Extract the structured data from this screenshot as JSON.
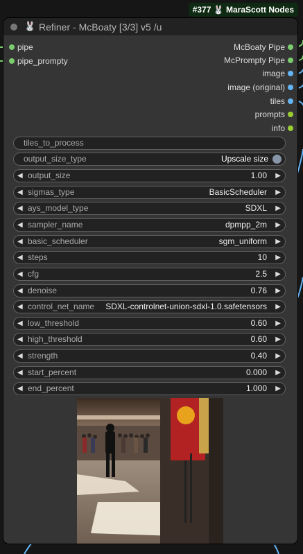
{
  "badge": {
    "text": "#377 🐰 MaraScott Nodes"
  },
  "node": {
    "title": "Refiner - McBoaty [3/3] v5 /u",
    "inputs": [
      "pipe",
      "pipe_prompty"
    ],
    "outputs": [
      {
        "label": "McBoaty Pipe",
        "color": "#7bcc6e"
      },
      {
        "label": "McPrompty Pipe",
        "color": "#7bcc6e"
      },
      {
        "label": "image",
        "color": "#64b5f6"
      },
      {
        "label": "image (original)",
        "color": "#64b5f6"
      },
      {
        "label": "tiles",
        "color": "#64b5f6"
      },
      {
        "label": "prompts",
        "color": "#9acd32"
      },
      {
        "label": "info",
        "color": "#9acd32"
      }
    ],
    "widgets": {
      "tiles_to_process": {
        "name": "tiles_to_process",
        "value": ""
      },
      "output_size_type": {
        "name": "output_size_type",
        "value": "Upscale size"
      },
      "output_size": {
        "name": "output_size",
        "value": "1.00"
      },
      "sigmas_type": {
        "name": "sigmas_type",
        "value": "BasicScheduler"
      },
      "ays_model_type": {
        "name": "ays_model_type",
        "value": "SDXL"
      },
      "sampler_name": {
        "name": "sampler_name",
        "value": "dpmpp_2m"
      },
      "basic_scheduler": {
        "name": "basic_scheduler",
        "value": "sgm_uniform"
      },
      "steps": {
        "name": "steps",
        "value": "10"
      },
      "cfg": {
        "name": "cfg",
        "value": "2.5"
      },
      "denoise": {
        "name": "denoise",
        "value": "0.76"
      },
      "control_net_name": {
        "name": "control_net_name",
        "value": "SDXL-controlnet-union-sdxl-1.0.safetensors"
      },
      "low_threshold": {
        "name": "low_threshold",
        "value": "0.60"
      },
      "high_threshold": {
        "name": "high_threshold",
        "value": "0.60"
      },
      "strength": {
        "name": "strength",
        "value": "0.40"
      },
      "start_percent": {
        "name": "start_percent",
        "value": "0.000"
      },
      "end_percent": {
        "name": "end_percent",
        "value": "1.000"
      }
    }
  }
}
